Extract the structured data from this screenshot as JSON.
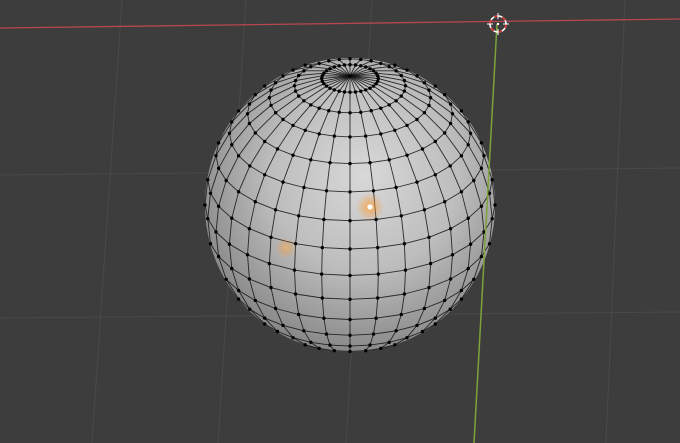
{
  "viewport": {
    "mode": "edit-mode",
    "object": "uv-sphere",
    "selection": "vertex-select",
    "selected_vertex_count": 1
  },
  "colors": {
    "background": "#3d3d3d",
    "grid_line": "#4a4a4a",
    "x_axis": "#b5474f",
    "y_axis": "#7da33a",
    "mesh_edge": "#111111",
    "vertex": "#000000",
    "selected_vertex": "#ffffff",
    "selected_glow": "#ff9a2e",
    "sphere_light": "#d4d4d4",
    "sphere_dark": "#6a6a6a",
    "cursor_ring": "#ffffff",
    "cursor_accent": "#d9342b"
  },
  "icons": {
    "cursor": "3d-cursor-icon"
  },
  "mesh": {
    "rings": 16,
    "segments": 32
  }
}
